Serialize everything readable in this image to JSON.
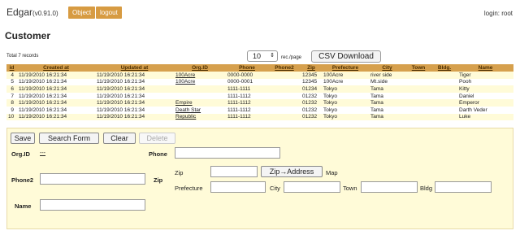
{
  "header": {
    "app_name": "Edgar",
    "version": "(v0.91.0)",
    "object_label": "Object",
    "logout_label": "logout",
    "login_text": "login: root"
  },
  "page_title": "Customer",
  "total_records": "Total 7 records",
  "pagination": {
    "per_page_value": "10",
    "per_page_label": "rec./page",
    "csv_label": "CSV Download"
  },
  "table": {
    "columns": [
      "id",
      "Created at",
      "Updated at",
      "Org.ID",
      "Phone",
      "Phone2",
      "Zip",
      "Prefecture",
      "City",
      "Town",
      "Bldg.",
      "Name"
    ],
    "rows": [
      [
        "4",
        "11/19/2010 16:21:34",
        "11/19/2010 16:21:34",
        "100Acre",
        "0000-0000",
        "",
        "12345",
        "100Acre",
        "river side",
        "",
        "",
        "Tiger"
      ],
      [
        "5",
        "11/19/2010 16:21:34",
        "11/19/2010 16:21:34",
        "100Acre",
        "0000-0001",
        "",
        "12345",
        "100Acre",
        "Mt.side",
        "",
        "",
        "Pooh"
      ],
      [
        "6",
        "11/19/2010 16:21:34",
        "11/19/2010 16:21:34",
        "",
        "1111-1111",
        "",
        "01234",
        "Tokyo",
        "Tama",
        "",
        "",
        "Kitty"
      ],
      [
        "7",
        "11/19/2010 16:21:34",
        "11/19/2010 16:21:34",
        "",
        "1111-1112",
        "",
        "01232",
        "Tokyo",
        "Tama",
        "",
        "",
        "Daniel"
      ],
      [
        "8",
        "11/19/2010 16:21:34",
        "11/19/2010 16:21:34",
        "Empire",
        "1111-1112",
        "",
        "01232",
        "Tokyo",
        "Tama",
        "",
        "",
        "Emperor"
      ],
      [
        "9",
        "11/19/2010 16:21:34",
        "11/19/2010 16:21:34",
        "Death Star",
        "1111-1112",
        "",
        "01232",
        "Tokyo",
        "Tama",
        "",
        "",
        "Darth Veder"
      ],
      [
        "10",
        "11/19/2010 16:21:34",
        "11/19/2010 16:21:34",
        "Republic",
        "1111-1112",
        "",
        "01232",
        "Tokyo",
        "Tama",
        "",
        "",
        "Luke"
      ]
    ]
  },
  "form": {
    "save_label": "Save",
    "search_form_label": "Search Form",
    "clear_label": "Clear",
    "delete_label": "Delete",
    "orgid_label": "Org.ID",
    "orgid_value": "---",
    "phone_label": "Phone",
    "phone2_label": "Phone2",
    "zip_label": "Zip",
    "zip_sub_label": "Zip",
    "zip_button_label": "Zip→Address",
    "map_label": "Map",
    "prefecture_label": "Prefecture",
    "city_label": "City",
    "town_label": "Town",
    "bldg_label": "Bldg",
    "name_label": "Name",
    "phone_value": "",
    "phone2_value": "",
    "zip_value": "",
    "prefecture_value": "",
    "city_value": "",
    "town_value": "",
    "bldg_value": "",
    "name_value": ""
  }
}
